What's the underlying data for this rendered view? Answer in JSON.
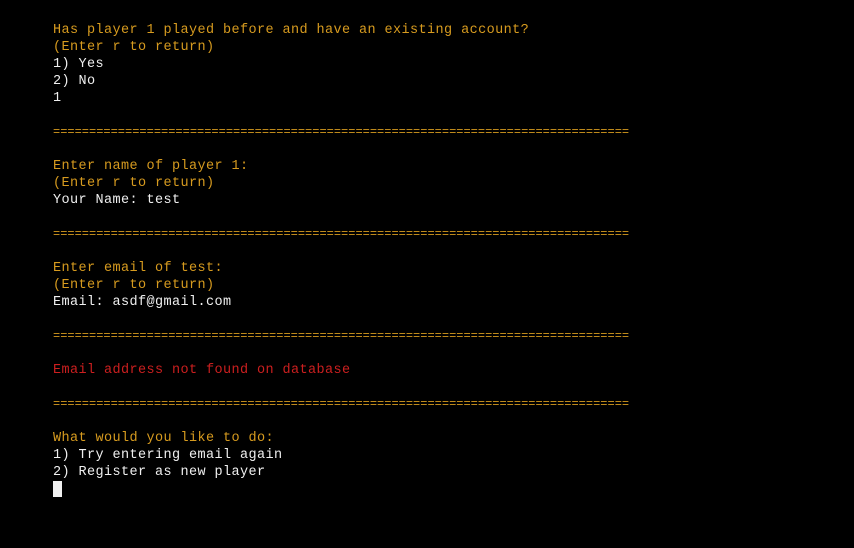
{
  "session": {
    "q1": {
      "prompt": "Has player 1 played before and have an existing account?",
      "hint": "(Enter r to return)",
      "options": [
        "1) Yes",
        "2) No"
      ],
      "input": "1"
    },
    "divider": "================================================================================",
    "q2": {
      "prompt": "Enter name of player 1:",
      "hint": "(Enter r to return)",
      "input_line": "Your Name: test"
    },
    "q3": {
      "prompt": "Enter email of test:",
      "hint": "(Enter r to return)",
      "input_line": "Email: asdf@gmail.com"
    },
    "error": "Email address not found on database",
    "q4": {
      "prompt": "What would you like to do:",
      "options": [
        "1) Try entering email again",
        "2) Register as new player"
      ]
    }
  },
  "colors": {
    "background": "#000000",
    "prompt": "#d79b1f",
    "output": "#f0f0f0",
    "error": "#cc1f1f"
  }
}
